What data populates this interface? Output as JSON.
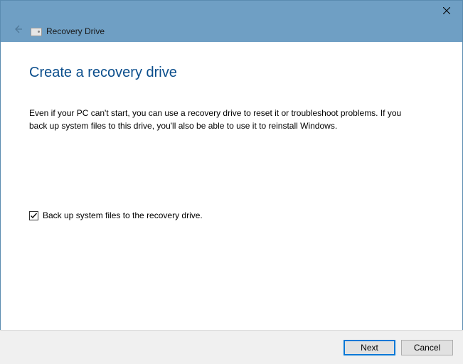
{
  "titlebar": {
    "title": "Recovery Drive"
  },
  "main": {
    "heading": "Create a recovery drive",
    "description": "Even if your PC can't start, you can use a recovery drive to reset it or troubleshoot problems. If you back up system files to this drive, you'll also be able to use it to reinstall Windows.",
    "checkbox_label": "Back up system files to the recovery drive.",
    "checkbox_checked": true
  },
  "footer": {
    "next_label": "Next",
    "cancel_label": "Cancel"
  }
}
